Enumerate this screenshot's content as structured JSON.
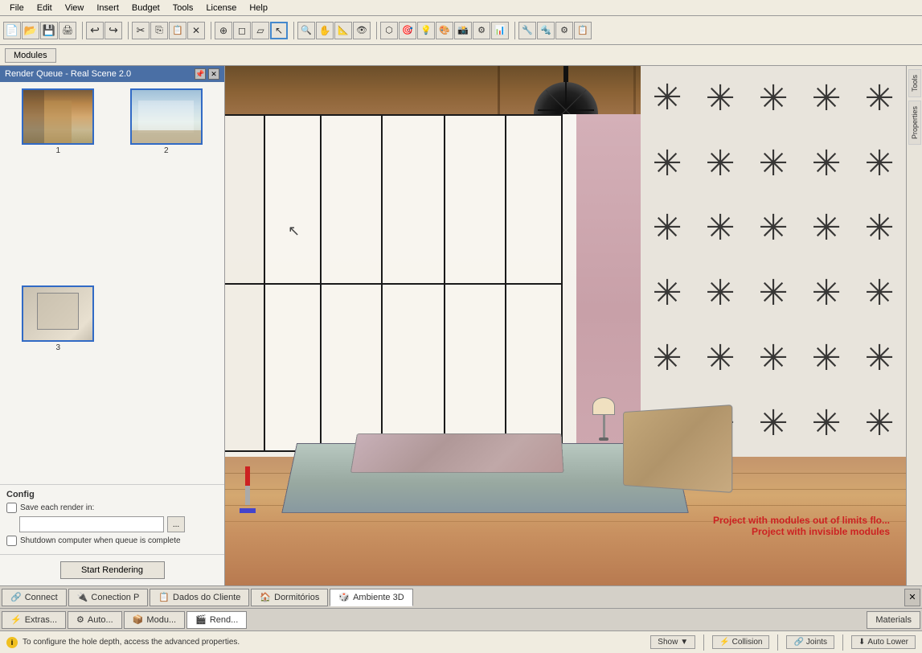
{
  "app": {
    "title": "Render Queue - Real Scene 2.0"
  },
  "menubar": {
    "items": [
      "File",
      "Edit",
      "View",
      "Insert",
      "Budget",
      "Tools",
      "License",
      "Help"
    ]
  },
  "toolbar": {
    "groups": [
      {
        "buttons": [
          "new",
          "open",
          "save",
          "export",
          "print"
        ]
      },
      {
        "buttons": [
          "undo",
          "redo"
        ]
      },
      {
        "buttons": [
          "cut",
          "copy",
          "paste",
          "delete"
        ]
      },
      {
        "buttons": [
          "tool1",
          "tool2",
          "tool3",
          "tool4"
        ]
      },
      {
        "buttons": [
          "select"
        ]
      },
      {
        "buttons": [
          "zoom",
          "pan",
          "rotate"
        ]
      },
      {
        "buttons": [
          "render",
          "material",
          "light"
        ]
      },
      {
        "buttons": [
          "measure",
          "section"
        ]
      },
      {
        "buttons": [
          "settings"
        ]
      }
    ]
  },
  "modules_tab": {
    "label": "Modules"
  },
  "panel": {
    "title": "Render Queue - Real Scene 2.0",
    "pin_icon": "📌",
    "close_icon": "✕",
    "thumbnails": [
      {
        "id": 1,
        "label": "1"
      },
      {
        "id": 2,
        "label": "2"
      },
      {
        "id": 3,
        "label": "3"
      }
    ]
  },
  "config": {
    "title": "Config",
    "save_each_render_label": "Save each render in:",
    "save_each_render_checked": false,
    "input_placeholder": "",
    "browse_label": "...",
    "shutdown_label": "Shutdown computer when queue is complete",
    "shutdown_checked": false,
    "start_button_label": "Start Rendering"
  },
  "viewport": {
    "warning_line1": "Project with modules out of limits flo...",
    "warning_line2": "Project with invisible modules"
  },
  "statusbar": {
    "info_text": "To configure the hole depth, access the advanced properties.",
    "show_label": "Show",
    "collision_label": "Collision",
    "joints_label": "Joints",
    "auto_lower_label": "Auto Lower"
  },
  "bottom_tabs": {
    "tabs": [
      {
        "label": "Extras...",
        "icon": "⚡",
        "active": false
      },
      {
        "label": "Auto...",
        "icon": "⚙",
        "active": false
      },
      {
        "label": "Modu...",
        "icon": "📦",
        "active": false
      },
      {
        "label": "Rend...",
        "icon": "🎬",
        "active": true
      }
    ]
  },
  "tab_bar": {
    "tabs": [
      {
        "label": "Connect",
        "icon": "🔗",
        "active": false
      },
      {
        "label": "Conection P",
        "icon": "🔌",
        "active": false
      },
      {
        "label": "Dados do Cliente",
        "icon": "📋",
        "active": false
      },
      {
        "label": "Dormitórios",
        "icon": "🏠",
        "active": false
      },
      {
        "label": "Ambiente 3D",
        "icon": "🎲",
        "active": false
      }
    ]
  },
  "materials_tab": {
    "label": "Materials"
  },
  "side_tools": {
    "tools_label": "Tools",
    "properties_label": "Properties"
  }
}
